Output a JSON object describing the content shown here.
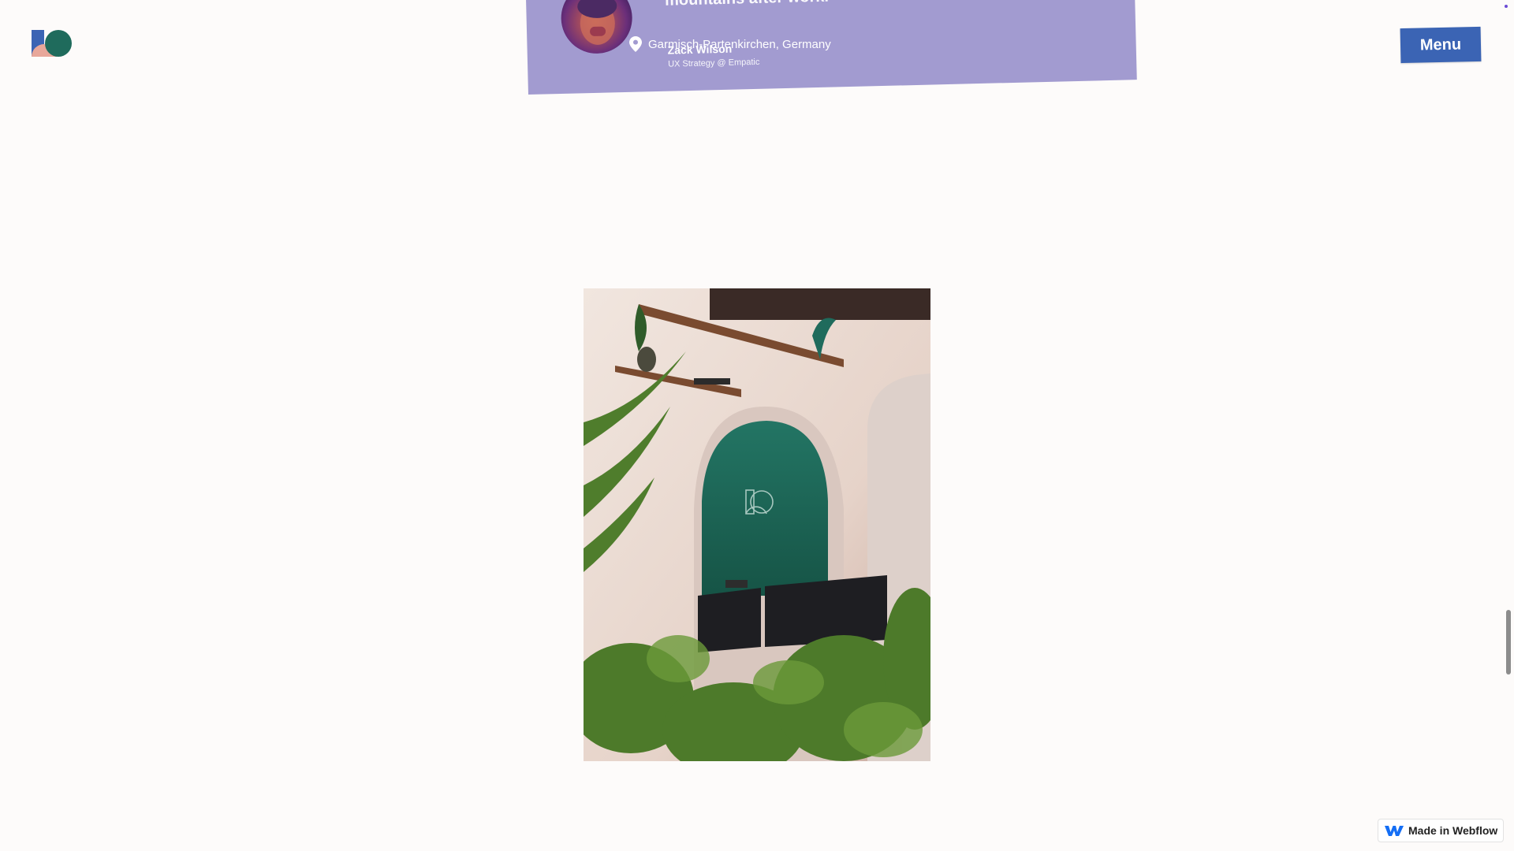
{
  "header": {
    "menu_label": "Menu"
  },
  "testimonial": {
    "quote": "to get focused and I really enjoyed the hike in the mountains after work.",
    "location": "Garmisch-Partenkirchen, Germany",
    "name": "Zack Wilson",
    "role": "UX Strategy @ Empatic"
  },
  "badge": {
    "label": "Made in Webflow"
  },
  "colors": {
    "background": "#fdfbfa",
    "card": "#a29bd0",
    "menu_button": "#3b64b4",
    "wall_green": "#1f6b5c"
  }
}
